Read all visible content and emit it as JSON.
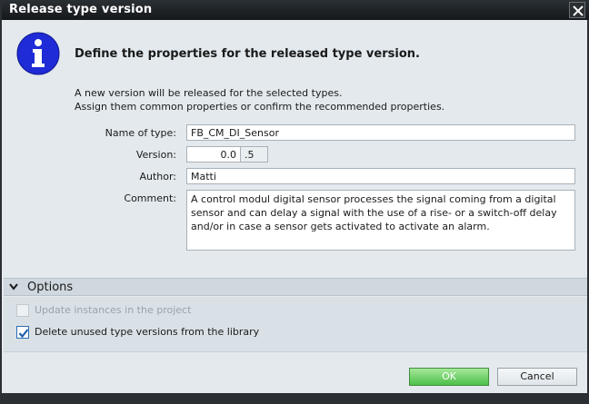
{
  "window": {
    "title": "Release type version"
  },
  "header": {
    "icon": "info-icon",
    "text": "Define the properties for the released type version."
  },
  "description": {
    "line1": "A new version will be released for the selected types.",
    "line2": "Assign them common properties or confirm the recommended properties."
  },
  "form": {
    "name_label": "Name of type:",
    "name_value": "FB_CM_DI_Sensor",
    "version_label": "Version:",
    "version_value": "0.0",
    "version_suffix": ".5",
    "author_label": "Author:",
    "author_value": "Matti",
    "comment_label": "Comment:",
    "comment_value": "A control modul digital sensor processes the signal coming from a digital sensor and can delay a signal with the use of a rise- or a switch-off delay and/or in case a sensor gets activated to activate an alarm."
  },
  "options": {
    "title": "Options",
    "update_instances_label": "Update instances in the project",
    "update_instances_checked": false,
    "update_instances_enabled": false,
    "delete_unused_label": "Delete unused type versions from the library",
    "delete_unused_checked": true
  },
  "buttons": {
    "ok": "OK",
    "cancel": "Cancel"
  },
  "colors": {
    "title_bar": "#1e2226",
    "ok_button": "#4ec04a",
    "info_icon": "#1e2bd6"
  }
}
